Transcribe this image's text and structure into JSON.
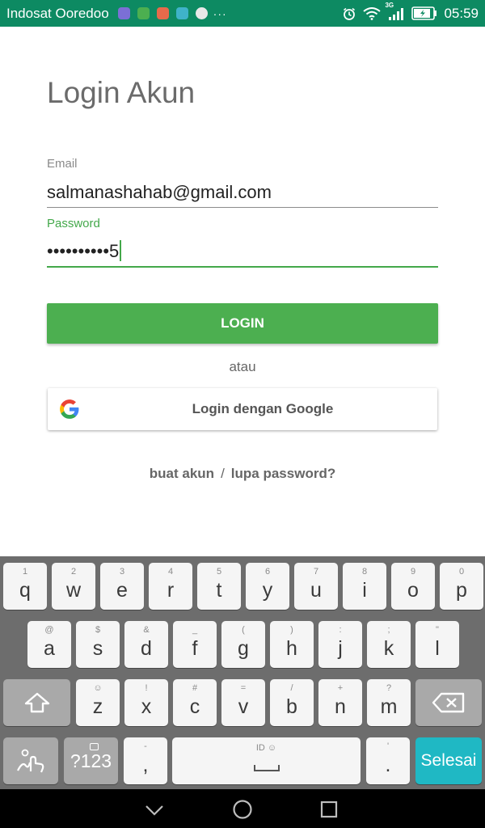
{
  "status_bar": {
    "carrier": "Indosat Ooredoo",
    "network": "3G",
    "time": "05:59",
    "overflow": "···",
    "app_icon_colors": [
      "#7b6fd6",
      "#4caf50",
      "#e76a4b",
      "#3fb3c9",
      "#e8e8e8"
    ]
  },
  "page": {
    "title": "Login Akun",
    "email_label": "Email",
    "email_value": "salmanashahab@gmail.com",
    "password_label": "Password",
    "password_masked": "••••••••••",
    "password_last_char": "5",
    "login_button": "LOGIN",
    "or_text": "atau",
    "google_button": "Login dengan Google",
    "create_account_link": "buat akun",
    "link_separator": "/",
    "forgot_password_link": "lupa password?"
  },
  "colors": {
    "accent_green": "#4caf50",
    "status_bar": "#0d8a62",
    "keyboard_bg": "#6d6d6d",
    "done_key": "#1fb8c4"
  },
  "keyboard": {
    "row1": [
      {
        "hint": "1",
        "key": "q"
      },
      {
        "hint": "2",
        "key": "w"
      },
      {
        "hint": "3",
        "key": "e"
      },
      {
        "hint": "4",
        "key": "r"
      },
      {
        "hint": "5",
        "key": "t"
      },
      {
        "hint": "6",
        "key": "y"
      },
      {
        "hint": "7",
        "key": "u"
      },
      {
        "hint": "8",
        "key": "i"
      },
      {
        "hint": "9",
        "key": "o"
      },
      {
        "hint": "0",
        "key": "p"
      }
    ],
    "row2": [
      {
        "hint": "@",
        "key": "a"
      },
      {
        "hint": "$",
        "key": "s"
      },
      {
        "hint": "&",
        "key": "d"
      },
      {
        "hint": "_",
        "key": "f"
      },
      {
        "hint": "(",
        "key": "g"
      },
      {
        "hint": ")",
        "key": "h"
      },
      {
        "hint": ":",
        "key": "j"
      },
      {
        "hint": ";",
        "key": "k"
      },
      {
        "hint": "\"",
        "key": "l"
      }
    ],
    "row3": [
      {
        "hint": "☺",
        "key": "z"
      },
      {
        "hint": "!",
        "key": "x"
      },
      {
        "hint": "#",
        "key": "c"
      },
      {
        "hint": "=",
        "key": "v"
      },
      {
        "hint": "/",
        "key": "b"
      },
      {
        "hint": "+",
        "key": "n"
      },
      {
        "hint": "?",
        "key": "m"
      }
    ],
    "symbols_key": "?123",
    "comma_hint": "-",
    "comma_key": ",",
    "space_hint": "ID ☺",
    "period_hint": "'",
    "period_key": ".",
    "done_key": "Selesai",
    "shift_icon": "shift-icon",
    "backspace_icon": "backspace-icon",
    "gesture_icon": "swipe-typing-icon"
  },
  "nav_bar": {
    "back_icon": "chevron-down-icon",
    "home_icon": "circle-home-icon",
    "recents_icon": "square-recents-icon"
  }
}
